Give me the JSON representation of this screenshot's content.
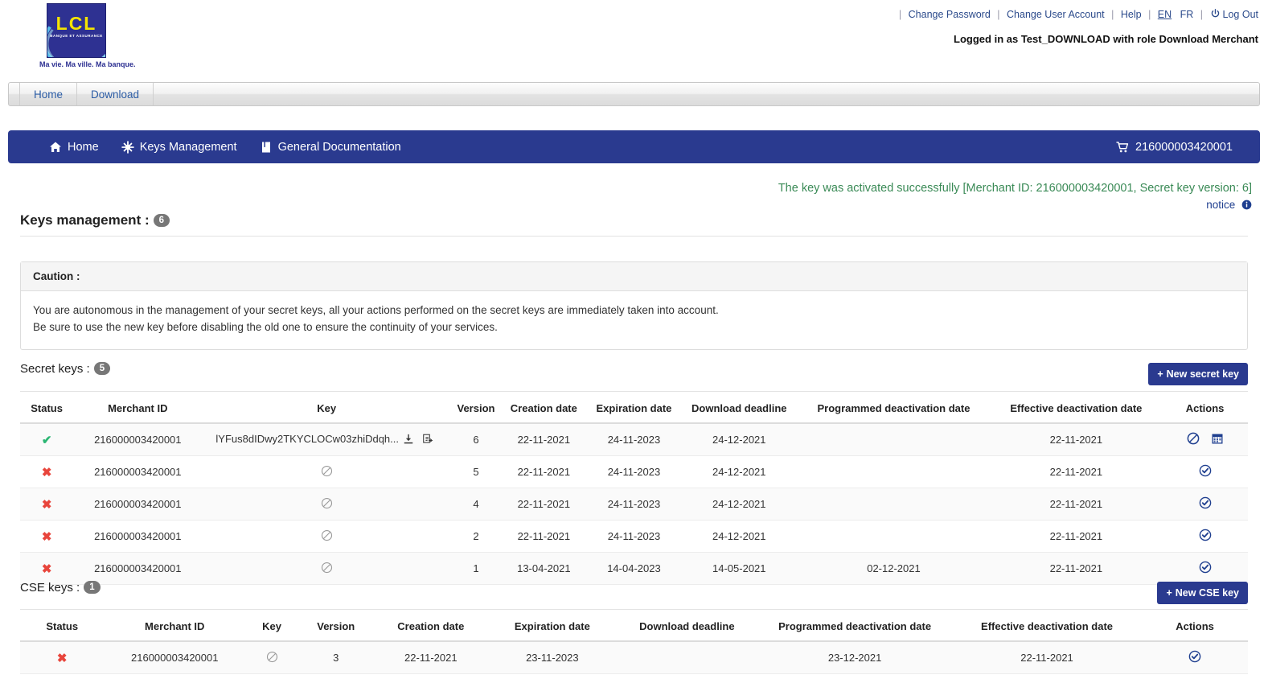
{
  "brand": {
    "logo_text": "LCL",
    "logo_subtext": "BANQUE ET ASSURANCE",
    "tagline": "Ma vie. Ma ville. Ma banque."
  },
  "header": {
    "links": [
      {
        "label": "Change Password"
      },
      {
        "label": "Change User Account"
      },
      {
        "label": "Help"
      }
    ],
    "lang_en": "EN",
    "lang_fr": "FR",
    "logout": "Log Out",
    "logged_in": "Logged in as Test_DOWNLOAD with role Download Merchant"
  },
  "tabs": [
    {
      "label": "Home"
    },
    {
      "label": "Download"
    }
  ],
  "nav": {
    "items": [
      {
        "label": "Home",
        "icon": "home-icon"
      },
      {
        "label": "Keys Management",
        "icon": "asterisk-icon"
      },
      {
        "label": "General Documentation",
        "icon": "book-icon"
      }
    ],
    "merchant_id": "216000003420001",
    "merchant_icon": "cart-icon"
  },
  "notice": {
    "message": "The key was activated successfully [Merchant ID: 216000003420001, Secret key version: 6]",
    "link": "notice",
    "color": "#3a8a56"
  },
  "page": {
    "title": "Keys management :",
    "count": "6"
  },
  "caution": {
    "heading": "Caution :",
    "line1": "You are autonomous in the management of your secret keys, all your actions performed on the secret keys are immediately taken into account.",
    "line2": "Be sure to use the new key before disabling the old one to ensure the continuity of your services."
  },
  "secret_keys": {
    "title": "Secret keys :",
    "count": "5",
    "new_button": "New secret key",
    "columns": [
      "Status",
      "Merchant ID",
      "Key",
      "Version",
      "Creation date",
      "Expiration date",
      "Download deadline",
      "Programmed deactivation date",
      "Effective deactivation date",
      "Actions"
    ],
    "rows": [
      {
        "status": "active",
        "merchant_id": "216000003420001",
        "key": "lYFus8dIDwy2TKYCLOCw03zhiDdqh...",
        "key_disabled": false,
        "version": "6",
        "creation_date": "22-11-2021",
        "expiration_date": "24-11-2023",
        "download_deadline": "24-12-2021",
        "programmed_deactivation_date": "",
        "effective_deactivation_date": "22-11-2021",
        "actions": [
          "disable-icon",
          "calendar-icon"
        ]
      },
      {
        "status": "inactive",
        "merchant_id": "216000003420001",
        "key": "",
        "key_disabled": true,
        "version": "5",
        "creation_date": "22-11-2021",
        "expiration_date": "24-11-2023",
        "download_deadline": "24-12-2021",
        "programmed_deactivation_date": "",
        "effective_deactivation_date": "22-11-2021",
        "actions": [
          "activate-icon"
        ]
      },
      {
        "status": "inactive",
        "merchant_id": "216000003420001",
        "key": "",
        "key_disabled": true,
        "version": "4",
        "creation_date": "22-11-2021",
        "expiration_date": "24-11-2023",
        "download_deadline": "24-12-2021",
        "programmed_deactivation_date": "",
        "effective_deactivation_date": "22-11-2021",
        "actions": [
          "activate-icon"
        ]
      },
      {
        "status": "inactive",
        "merchant_id": "216000003420001",
        "key": "",
        "key_disabled": true,
        "version": "2",
        "creation_date": "22-11-2021",
        "expiration_date": "24-11-2023",
        "download_deadline": "24-12-2021",
        "programmed_deactivation_date": "",
        "effective_deactivation_date": "22-11-2021",
        "actions": [
          "activate-icon"
        ]
      },
      {
        "status": "inactive",
        "merchant_id": "216000003420001",
        "key": "",
        "key_disabled": true,
        "version": "1",
        "creation_date": "13-04-2021",
        "expiration_date": "14-04-2023",
        "download_deadline": "14-05-2021",
        "programmed_deactivation_date": "02-12-2021",
        "effective_deactivation_date": "22-11-2021",
        "actions": [
          "activate-icon"
        ]
      }
    ]
  },
  "cse_keys": {
    "title": "CSE keys :",
    "count": "1",
    "new_button": "New CSE key",
    "columns": [
      "Status",
      "Merchant ID",
      "Key",
      "Version",
      "Creation date",
      "Expiration date",
      "Download deadline",
      "Programmed deactivation date",
      "Effective deactivation date",
      "Actions"
    ],
    "rows": [
      {
        "status": "inactive",
        "merchant_id": "216000003420001",
        "key": "",
        "key_disabled": true,
        "version": "3",
        "creation_date": "22-11-2021",
        "expiration_date": "23-11-2023",
        "download_deadline": "",
        "programmed_deactivation_date": "23-12-2021",
        "effective_deactivation_date": "22-11-2021",
        "actions": [
          "activate-icon"
        ]
      }
    ]
  },
  "colors": {
    "nav_blue": "#2a3a8f",
    "success_green": "#3a8a56",
    "error_red": "#e8453c",
    "badge_gray": "#777777"
  }
}
